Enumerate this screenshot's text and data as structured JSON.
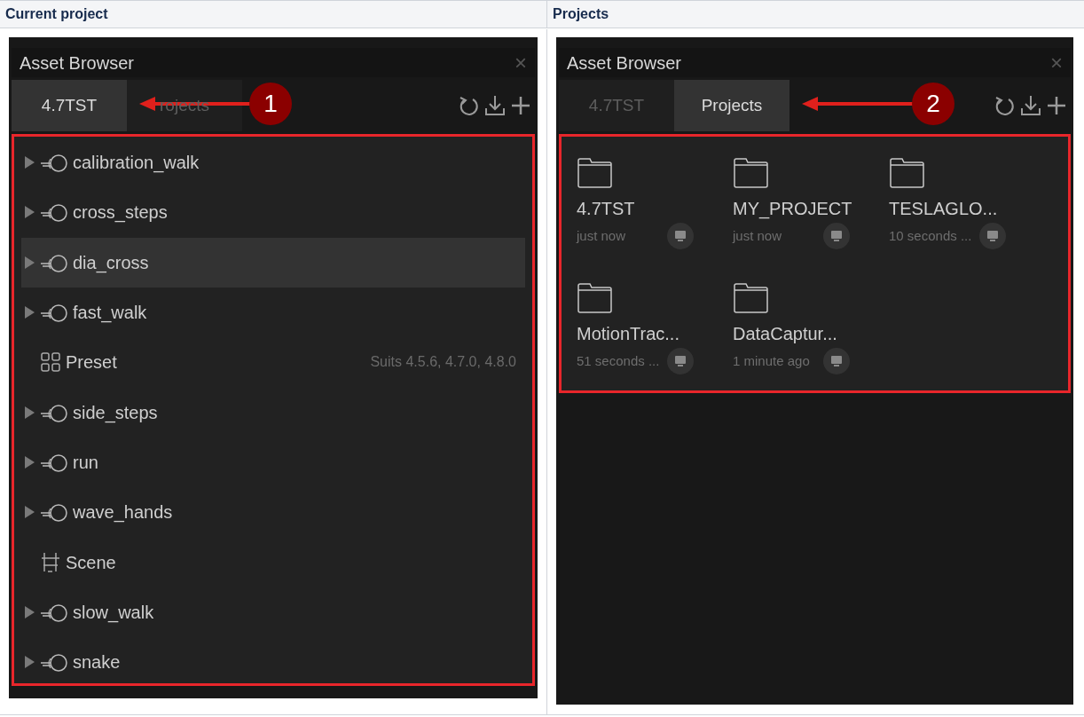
{
  "columns": [
    {
      "heading": "Current project",
      "panel": {
        "title": "Asset Browser",
        "close": "×",
        "tabs": [
          {
            "label": "4.7TST",
            "selected": true
          },
          {
            "label": "rojects",
            "selected": false
          }
        ],
        "callout": "1",
        "content": {
          "kind": "tree",
          "rows": [
            {
              "kind": "animation",
              "label": "calibration_walk",
              "selected": false
            },
            {
              "kind": "animation",
              "label": "cross_steps",
              "selected": false
            },
            {
              "kind": "animation",
              "label": "dia_cross",
              "selected": true
            },
            {
              "kind": "animation",
              "label": "fast_walk",
              "selected": false
            },
            {
              "kind": "preset",
              "label": "Preset",
              "note": "Suits 4.5.6, 4.7.0, 4.8.0",
              "selected": false
            },
            {
              "kind": "animation",
              "label": "side_steps",
              "selected": false
            },
            {
              "kind": "animation",
              "label": "run",
              "selected": false
            },
            {
              "kind": "animation",
              "label": "wave_hands",
              "selected": false
            },
            {
              "kind": "scene",
              "label": "Scene",
              "selected": false
            },
            {
              "kind": "animation",
              "label": "slow_walk",
              "selected": false
            },
            {
              "kind": "animation",
              "label": "snake",
              "selected": false
            }
          ]
        }
      }
    },
    {
      "heading": "Projects",
      "panel": {
        "title": "Asset Browser",
        "close": "×",
        "tabs": [
          {
            "label": "4.7TST",
            "selected": false
          },
          {
            "label": "Projects",
            "selected": true
          }
        ],
        "callout": "2",
        "content": {
          "kind": "grid",
          "cards": [
            {
              "name": "4.7TST",
              "time": "just now"
            },
            {
              "name": "MY_PROJECT",
              "time": "just now"
            },
            {
              "name": "TESLAGLO...",
              "time": "10 seconds ..."
            },
            {
              "name": "MotionTrac...",
              "time": "51 seconds ..."
            },
            {
              "name": "DataCaptur...",
              "time": "1 minute ago"
            }
          ]
        }
      }
    }
  ]
}
